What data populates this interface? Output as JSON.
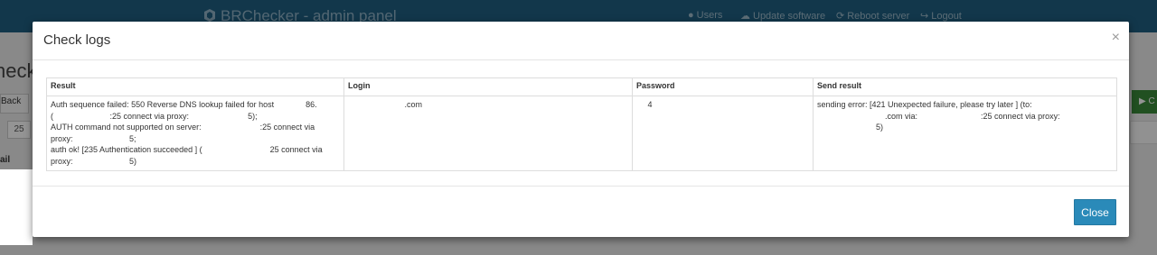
{
  "app": {
    "brand": "BRChecker - admin panel",
    "nav": [
      {
        "label": "Users",
        "icon": "user-icon"
      },
      {
        "label": "Update software",
        "icon": "cloud-icon"
      },
      {
        "label": "Reboot server",
        "icon": "refresh-icon"
      },
      {
        "label": "Logout",
        "icon": "logout-icon"
      }
    ],
    "page_title_fragment": "neck",
    "back_label": "Back",
    "page_size": "25",
    "column_fragment": "ail",
    "green_button_fragment": "C"
  },
  "modal": {
    "title": "Check logs",
    "close_x": "×",
    "table": {
      "headers": [
        "Result",
        "Login",
        "Password",
        "Send result"
      ],
      "row": {
        "result_lines": [
          "Auth sequence failed: 550 Reverse DNS lookup failed for host              86.",
          "(                         :25 connect via proxy:                          5);",
          "AUTH command not supported on server:                          :25 connect via",
          "proxy:                         5;",
          "auth ok! [235 Authentication succeeded ] (                              25 connect via",
          "proxy:                         5)"
        ],
        "login": "                         .com",
        "password": "     4",
        "send_result_lines": [
          "sending error: [421 Unexpected failure, please try later ] (to:",
          "                              .com via:                            :25 connect via proxy:",
          "                          5)"
        ]
      }
    },
    "close_button": "Close"
  }
}
